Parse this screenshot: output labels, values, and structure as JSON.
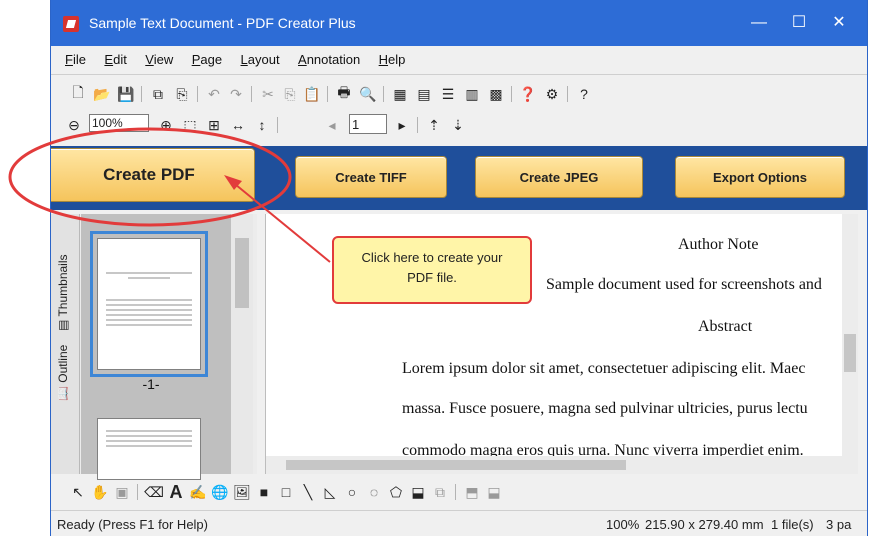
{
  "window": {
    "title": "Sample Text Document - PDF Creator Plus"
  },
  "titlebar": {
    "min_label": "—",
    "max_label": "☐",
    "close_label": "✕"
  },
  "menu": [
    {
      "hot": "F",
      "rest": "ile"
    },
    {
      "hot": "E",
      "rest": "dit"
    },
    {
      "hot": "V",
      "rest": "iew"
    },
    {
      "hot": "P",
      "rest": "age"
    },
    {
      "hot": "L",
      "rest": "ayout"
    },
    {
      "hot": "A",
      "rest": "nnotation"
    },
    {
      "hot": "H",
      "rest": "elp"
    }
  ],
  "zoom": {
    "value": "100%"
  },
  "page": {
    "value": "1"
  },
  "buttons": {
    "create_pdf": "Create PDF",
    "create_tiff": "Create TIFF",
    "create_jpeg": "Create JPEG",
    "export_options": "Export Options"
  },
  "sidebar": {
    "thumbnails_tab": "Thumbnails",
    "outline_tab": "Outline",
    "page_label": "-1-"
  },
  "document": {
    "author": "Author Note",
    "sample": "Sample document used for screenshots and",
    "abstract": "Abstract",
    "lorem1": "Lorem ipsum dolor sit amet, consectetuer adipiscing elit. Maec",
    "lorem2": "massa. Fusce posuere, magna sed pulvinar ultricies, purus lectu",
    "lorem3": "commodo magna eros quis urna. Nunc viverra imperdiet enim."
  },
  "callout": {
    "line1": "Click here to create your",
    "line2": "PDF file."
  },
  "status": {
    "help": "Ready (Press F1 for Help)",
    "zoom": "100%",
    "size": "215.90 x 279.40 mm",
    "files": "1 file(s)",
    "pages": "3 pa"
  },
  "colors": {
    "title_blue": "#2d6cd6",
    "band_blue": "#1f4f9b",
    "button_gold": "#f5c45c",
    "highlight_red": "#e23b3b"
  }
}
